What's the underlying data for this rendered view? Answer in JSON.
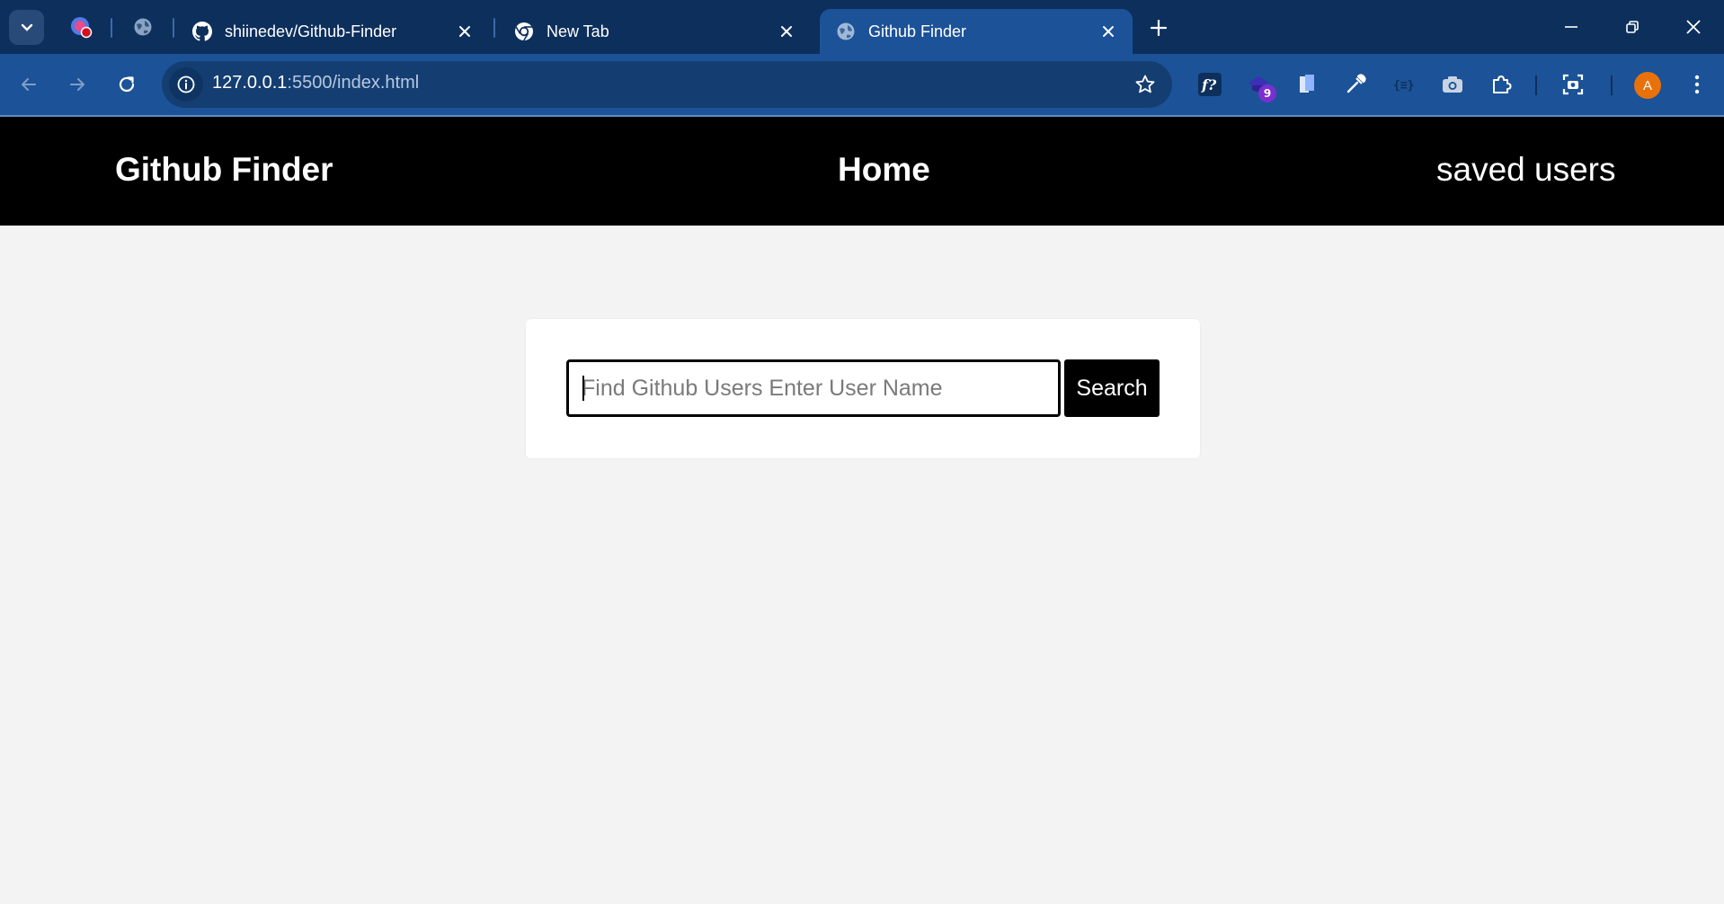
{
  "browser": {
    "tabs": [
      {
        "title": "shiinedev/Github-Finder",
        "icon": "github-icon"
      },
      {
        "title": "New Tab",
        "icon": "chrome-icon"
      },
      {
        "title": "Github Finder",
        "icon": "globe-icon",
        "active": true
      }
    ],
    "pinned_tabs": [
      "record-icon",
      "globe-icon"
    ],
    "address": {
      "host": "127.0.0.1",
      "path": ":5500/index.html"
    },
    "extensions": [
      {
        "name": "font-finder-icon",
        "label": "f?"
      },
      {
        "name": "extension-badge-icon",
        "badge": "9"
      },
      {
        "name": "document-icon"
      },
      {
        "name": "eyedropper-icon"
      },
      {
        "name": "json-icon",
        "label": "{≡}"
      },
      {
        "name": "camera-icon"
      },
      {
        "name": "puzzle-icon"
      },
      {
        "name": "screenshot-icon"
      }
    ],
    "profile_initial": "A",
    "colors": {
      "tabstrip": "#0d2f5c",
      "toolbar": "#1c5297",
      "omnibox": "#143e72",
      "avatar": "#e8710a"
    }
  },
  "page": {
    "brand": "Github Finder",
    "nav": {
      "home": "Home",
      "saved": "saved users"
    },
    "search": {
      "placeholder": "Find Github Users Enter User Name",
      "value": "",
      "button_label": "Search"
    },
    "colors": {
      "header": "#000000",
      "background": "#f3f3f3",
      "card": "#ffffff"
    }
  }
}
